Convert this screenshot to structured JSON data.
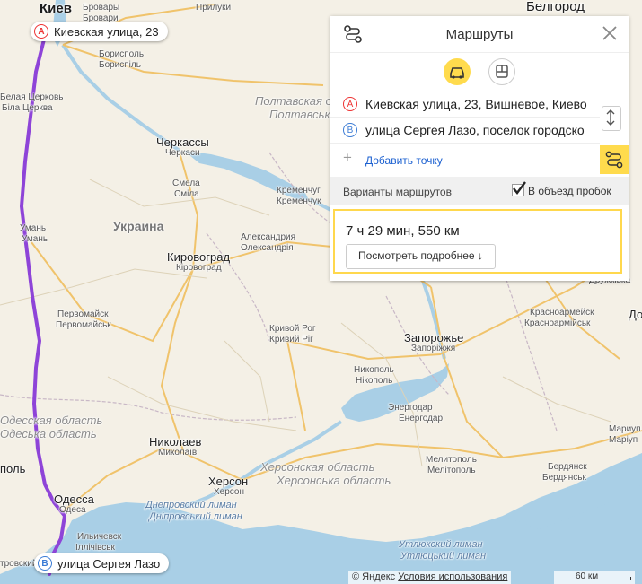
{
  "map": {
    "cities": [
      {
        "id": "kiev",
        "name": "Киев",
        "sub": "Київ"
      },
      {
        "id": "brovary",
        "name": "Бровары",
        "sub": "Бровари"
      },
      {
        "id": "boryspil",
        "name": "Борисполь",
        "sub": "Бориспіль"
      },
      {
        "id": "pryluky",
        "name": "Прилуки"
      },
      {
        "id": "belgorod",
        "name": "Белгород"
      },
      {
        "id": "belaya-cerkov",
        "name": "Белая Церковь",
        "sub": "Біла Церква"
      },
      {
        "id": "cherkasy",
        "name": "Черкассы",
        "sub": "Черкаси"
      },
      {
        "id": "smela",
        "name": "Смела",
        "sub": "Сміла"
      },
      {
        "id": "kremenchug",
        "name": "Кременчуг",
        "sub": "Кременчук"
      },
      {
        "id": "uman",
        "name": "Умань",
        "sub": "Умань"
      },
      {
        "id": "aleksandriya",
        "name": "Александрия",
        "sub": "Олександрія"
      },
      {
        "id": "kirovograd",
        "name": "Кировоград",
        "sub": "Кіровоград"
      },
      {
        "id": "pervomaisk",
        "name": "Первомайск",
        "sub": "Первомайськ"
      },
      {
        "id": "kryvyi-rih",
        "name": "Кривой Рог",
        "sub": "Кривий Ріг"
      },
      {
        "id": "zaporozhye",
        "name": "Запорожье",
        "sub": "Запоріжжя"
      },
      {
        "id": "nikopol",
        "name": "Никополь",
        "sub": "Нікополь"
      },
      {
        "id": "energodar",
        "name": "Энергодар",
        "sub": "Енергодар"
      },
      {
        "id": "krasnoarmeysk",
        "name": "Красноармейск",
        "sub": "Красноармійськ"
      },
      {
        "id": "druzhkovka",
        "sub": "Дружківка"
      },
      {
        "id": "nikolaev",
        "name": "Николаев",
        "sub": "Миколаїв"
      },
      {
        "id": "kherson",
        "name": "Херсон",
        "sub": "Херсон"
      },
      {
        "id": "melitopol",
        "name": "Мелитополь",
        "sub": "Мелітополь"
      },
      {
        "id": "berdyansk",
        "name": "Бердянск",
        "sub": "Бердянськ"
      },
      {
        "id": "mariupol",
        "name": "Мариуп",
        "sub": "Маріуп"
      },
      {
        "id": "odessa",
        "name": "Одесса",
        "sub": "Одеса"
      },
      {
        "id": "ilichevsk",
        "name": "Ильичевск",
        "sub": "Іллічівськ"
      },
      {
        "id": "tovsky",
        "name": "тровский"
      },
      {
        "id": "pol",
        "name": "поль"
      },
      {
        "id": "do",
        "name": "До"
      }
    ],
    "regions": {
      "poltava": "Полтавская область",
      "poltava_ua": "Полтавсько",
      "odessa": "Одесская область",
      "odessa_ua": "Одеська область",
      "kherson": "Херсонская область",
      "kherson_ua": "Херсонська область"
    },
    "country": "Украина",
    "water": {
      "dnipro_liman": "Днепровский лиман",
      "dnipro_liman_ua": "Дніпровський лиман",
      "utlyuk": "Утлюкский лиман",
      "utlyuk_ua": "Утлюцький лиман"
    },
    "colors": {
      "route": "#8e44d8",
      "sea": "#a9cfe6",
      "land": "#f4f0e6",
      "road": "#f0c36b"
    }
  },
  "pins": {
    "a": {
      "letter": "A",
      "label": "Киевская улица, 23"
    },
    "b": {
      "letter": "B",
      "label": "улица Сергея Лазо"
    }
  },
  "panel": {
    "title": "Маршруты",
    "icons": {
      "route": "route-icon",
      "close": "close-icon",
      "car": "car-icon",
      "bus": "bus-icon",
      "swap": "swap-icon"
    },
    "from": {
      "letter": "A",
      "value": "Киевская улица, 23, Вишневое, Киево"
    },
    "to": {
      "letter": "B",
      "value": "улица Сергея Лазо, поселок городско"
    },
    "add_point": "Добавить точку",
    "variants_label": "Варианты маршрутов",
    "avoid_traffic": "В объезд пробок",
    "avoid_traffic_checked": true,
    "summary": "7 ч 29 мин, 550 км",
    "details_button": "Посмотреть подробнее ↓"
  },
  "footer": {
    "copyright_sign": "©",
    "brand": "Яндекс",
    "terms": "Условия использования",
    "scale": "60 км"
  }
}
